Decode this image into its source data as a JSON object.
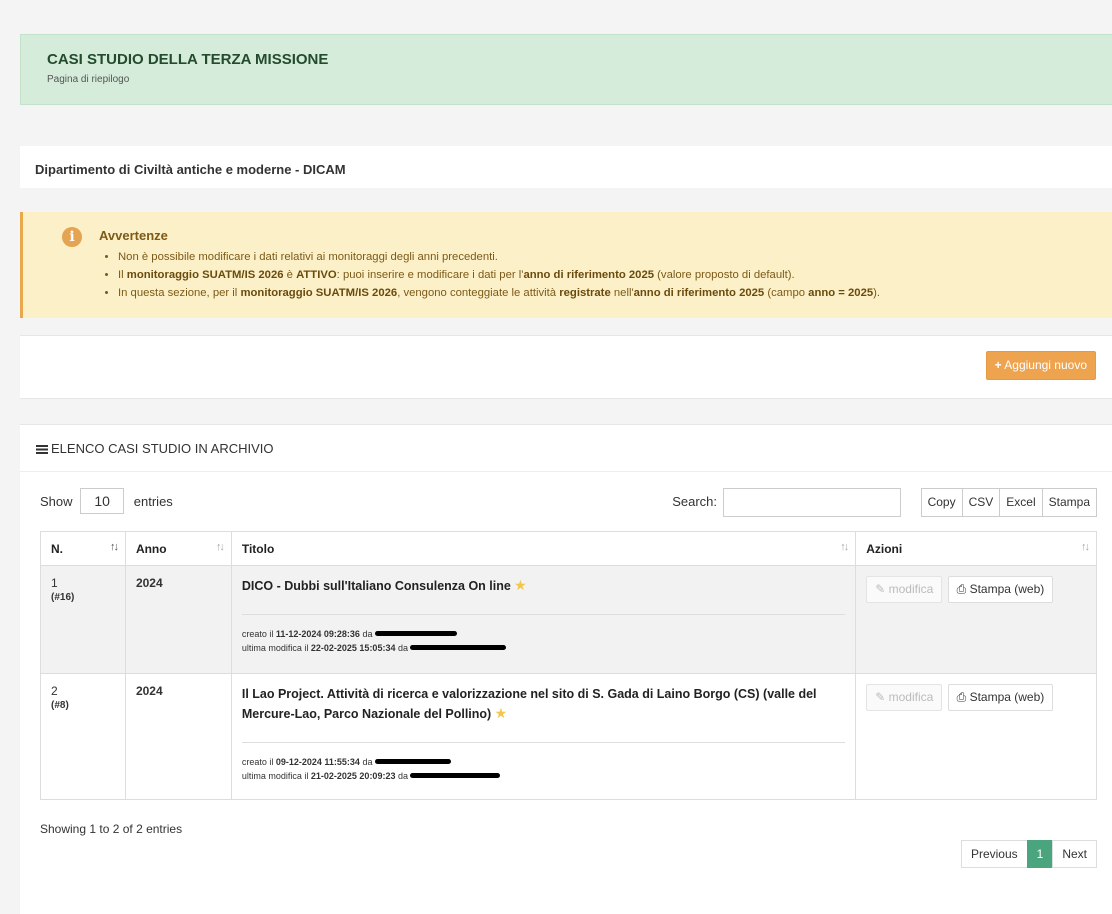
{
  "header": {
    "title": "CASI STUDIO DELLA TERZA MISSIONE",
    "subtitle": "Pagina di riepilogo"
  },
  "department": "Dipartimento di Civiltà antiche e moderne - DICAM",
  "warning": {
    "icon": "info-circle-icon",
    "title": "Avvertenze",
    "line1": "Non è possibile modificare i dati relativi ai monitoraggi degli anni precedenti.",
    "line2": {
      "a": "Il ",
      "b": "monitoraggio SUATM/IS 2026",
      "c": " è ",
      "d": "ATTIVO",
      "e": ": puoi inserire e modificare i dati per l'",
      "f": "anno di riferimento 2025",
      "g": " (valore proposto di default)."
    },
    "line3": {
      "a": "In questa sezione, per il ",
      "b": "monitoraggio SUATM/IS 2026",
      "c": ", vengono conteggiate le attività ",
      "d": "registrate",
      "e": " nell'",
      "f": "anno di riferimento 2025",
      "g": " (campo ",
      "h": "anno = 2025",
      "i": ")."
    }
  },
  "add_button": {
    "icon": "plus-icon",
    "label": "Aggiungi nuovo"
  },
  "list": {
    "heading": "ELENCO CASI STUDIO IN ARCHIVIO",
    "show_label": "Show",
    "page_length": "10",
    "entries_label": "entries",
    "search_label": "Search:",
    "search_value": "",
    "export_buttons": [
      "Copy",
      "CSV",
      "Excel",
      "Stampa"
    ],
    "columns": [
      "N.",
      "Anno",
      "Titolo",
      "Azioni"
    ],
    "rows": [
      {
        "n": "1",
        "id": "(#16)",
        "anno": "2024",
        "titolo": "DICO - Dubbi sull'Italiano Consulenza On line",
        "created_prefix": "creato il ",
        "created_at": "11-12-2024 09:28:36",
        "created_by_prefix": " da ",
        "modified_prefix": "ultima modifica il ",
        "modified_at": "22-02-2025 15:05:34",
        "modified_by_prefix": " da "
      },
      {
        "n": "2",
        "id": "(#8)",
        "anno": "2024",
        "titolo": "Il Lao Project. Attività di ricerca e valorizzazione nel sito di S. Gada di Laino Borgo (CS) (valle del Mercure-Lao, Parco Nazionale del Pollino)",
        "created_prefix": "creato il ",
        "created_at": "09-12-2024 11:55:34",
        "created_by_prefix": " da ",
        "modified_prefix": "ultima modifica il ",
        "modified_at": "21-02-2025 20:09:23",
        "modified_by_prefix": " da "
      }
    ],
    "actions": {
      "edit_label": "modifica",
      "print_label": "Stampa (web)"
    },
    "showing": "Showing 1 to 2 of 2 entries",
    "pagination": {
      "previous": "Previous",
      "current": "1",
      "next": "Next"
    }
  },
  "colors": {
    "header_bg": "#d5ecdb",
    "warning_bg": "#fcf0c8",
    "accent_orange": "#eea34f",
    "active_page": "#4aa57e"
  }
}
